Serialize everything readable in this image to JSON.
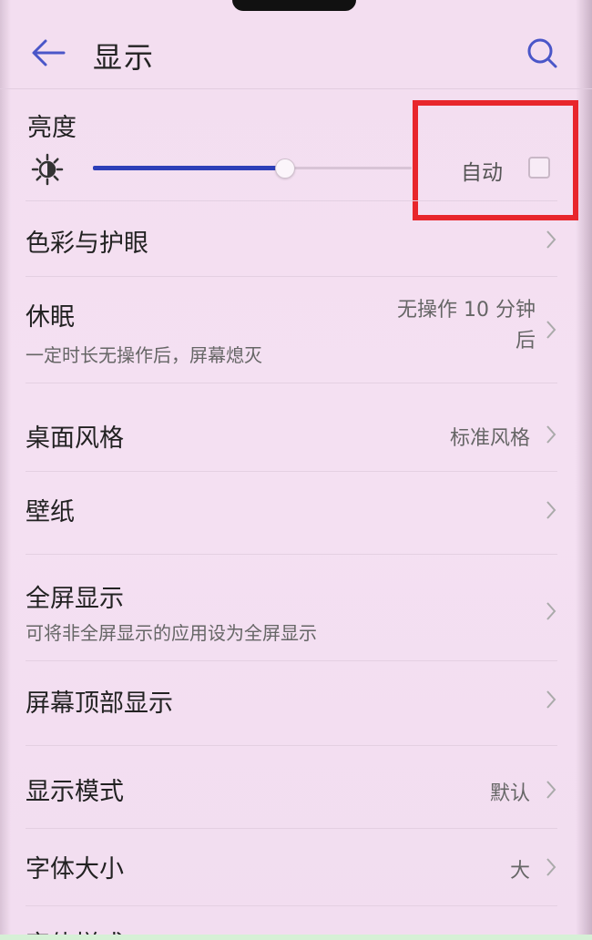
{
  "header": {
    "title": "显示",
    "back_icon": "arrow-left-icon",
    "search_icon": "search-icon"
  },
  "brightness": {
    "label": "亮度",
    "level_percent": 60,
    "auto_label": "自动",
    "auto_checked": false
  },
  "rows": [
    {
      "title": "色彩与护眼"
    },
    {
      "title": "休眠",
      "subtitle": "一定时长无操作后，屏幕熄灭",
      "value_line1": "无操作 10 分钟",
      "value_line2": "后"
    },
    {
      "title": "桌面风格",
      "value": "标准风格"
    },
    {
      "title": "壁纸"
    },
    {
      "title": "全屏显示",
      "subtitle": "可将非全屏显示的应用设为全屏显示"
    },
    {
      "title": "屏幕顶部显示"
    },
    {
      "title": "显示模式",
      "value": "默认"
    },
    {
      "title": "字体大小",
      "value": "大"
    },
    {
      "title": "字体样式"
    }
  ],
  "colors": {
    "background": "#f3def0",
    "accent": "#2d3fb8",
    "highlight": "#e8262c"
  }
}
